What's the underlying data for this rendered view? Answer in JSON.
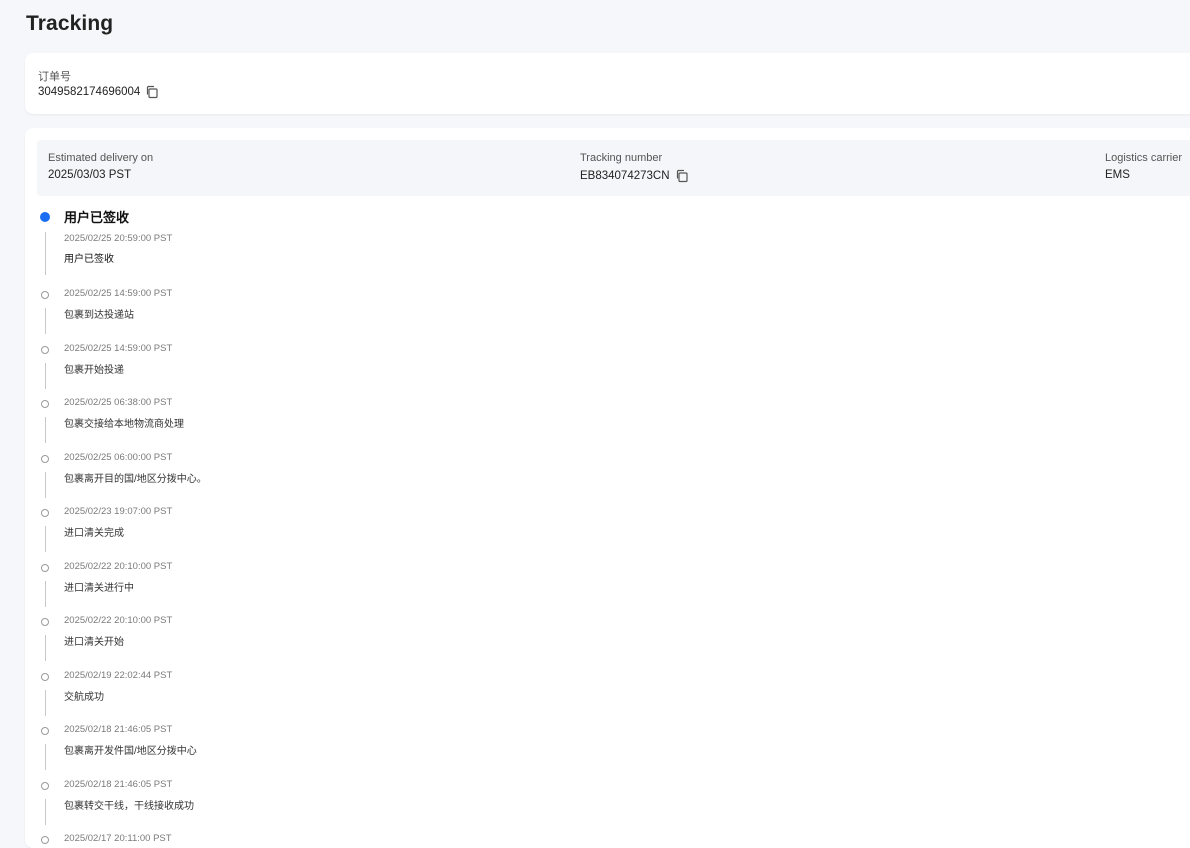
{
  "page": {
    "title": "Tracking"
  },
  "order": {
    "label": "订单号",
    "number": "3049582174696004"
  },
  "summary": {
    "delivery_label": "Estimated delivery on",
    "delivery_value": "2025/03/03 PST",
    "tracking_label": "Tracking number",
    "tracking_value": "EB834074273CN",
    "carrier_label": "Logistics carrier",
    "carrier_value": "EMS"
  },
  "timeline": {
    "current_status": "用户已签收",
    "events": [
      {
        "time": "2025/02/25 20:59:00 PST",
        "desc": "用户已签收"
      },
      {
        "time": "2025/02/25 14:59:00 PST",
        "desc": "包裹到达投递站"
      },
      {
        "time": "2025/02/25 14:59:00 PST",
        "desc": "包裹开始投递"
      },
      {
        "time": "2025/02/25 06:38:00 PST",
        "desc": "包裹交接给本地物流商处理"
      },
      {
        "time": "2025/02/25 06:00:00 PST",
        "desc": "包裹离开目的国/地区分拨中心。"
      },
      {
        "time": "2025/02/23 19:07:00 PST",
        "desc": "进口清关完成"
      },
      {
        "time": "2025/02/22 20:10:00 PST",
        "desc": "进口清关进行中"
      },
      {
        "time": "2025/02/22 20:10:00 PST",
        "desc": "进口清关开始"
      },
      {
        "time": "2025/02/19 22:02:44 PST",
        "desc": "交航成功"
      },
      {
        "time": "2025/02/18 21:46:05 PST",
        "desc": "包裹离开发件国/地区分拨中心"
      },
      {
        "time": "2025/02/18 21:46:05 PST",
        "desc": "包裹转交干线，干线接收成功"
      },
      {
        "time": "2025/02/17 20:11:00 PST",
        "desc": ""
      }
    ]
  },
  "colors": {
    "accent": "#1a6cf0",
    "background": "#f5f7fa",
    "card": "#ffffff"
  }
}
